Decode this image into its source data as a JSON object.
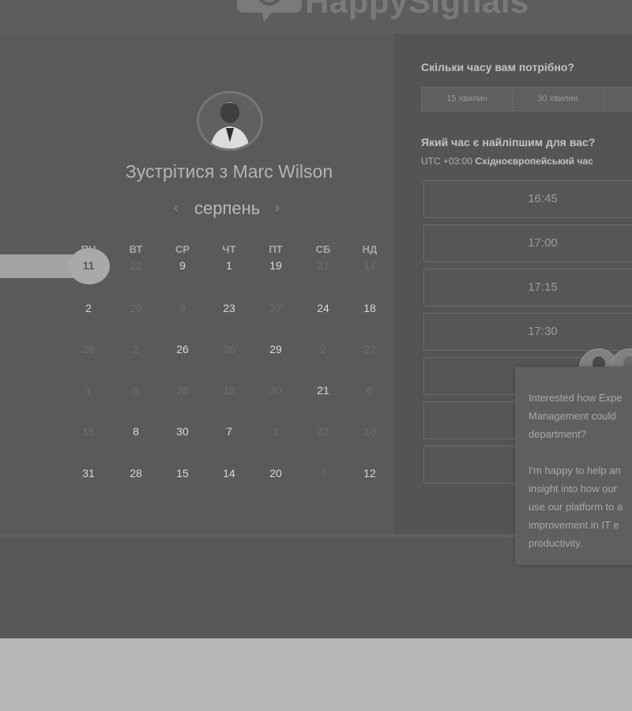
{
  "header": {
    "logo_text": "HappySignals"
  },
  "scheduler": {
    "meeting_title": "Зустрітися з Marc Wilson",
    "month": "серпень",
    "weekdays": [
      "ПН",
      "ВТ",
      "СР",
      "ЧТ",
      "ПТ",
      "СБ",
      "НД"
    ],
    "days": [
      [
        "11",
        "22",
        "9",
        "1",
        "19",
        "27",
        "17"
      ],
      [
        "2",
        "20",
        "9",
        "23",
        "27",
        "24",
        "18"
      ],
      [
        "28",
        "2",
        "26",
        "26",
        "29",
        "2",
        "27"
      ],
      [
        "1",
        "6",
        "28",
        "12",
        "30",
        "21",
        "6"
      ],
      [
        "15",
        "8",
        "30",
        "7",
        "1",
        "23",
        "10"
      ],
      [
        "31",
        "28",
        "15",
        "14",
        "20",
        "7",
        "12"
      ]
    ]
  },
  "booking": {
    "duration_question": "Скільки часу вам потрібно?",
    "durations": [
      "15 хвилин",
      "30 хвилин",
      ""
    ],
    "time_question": "Який час є найліпшим для вас?",
    "timezone_offset": "UTC +03:00",
    "timezone_name": "Східноєвропейський час",
    "slots": [
      "16:45",
      "17:00",
      "17:15",
      "17:30",
      "",
      "",
      ""
    ]
  },
  "chat": {
    "message": "Interested how Expe\nManagement could \ndepartment?\n\nI'm happy to help an\ninsight into how our \nuse our platform to a\nimprovement in IT e\nproductivity."
  },
  "colors": {
    "page_bg": "#b8b8b8",
    "overlay": "#585858",
    "selected_day": "#a9a9a9"
  }
}
